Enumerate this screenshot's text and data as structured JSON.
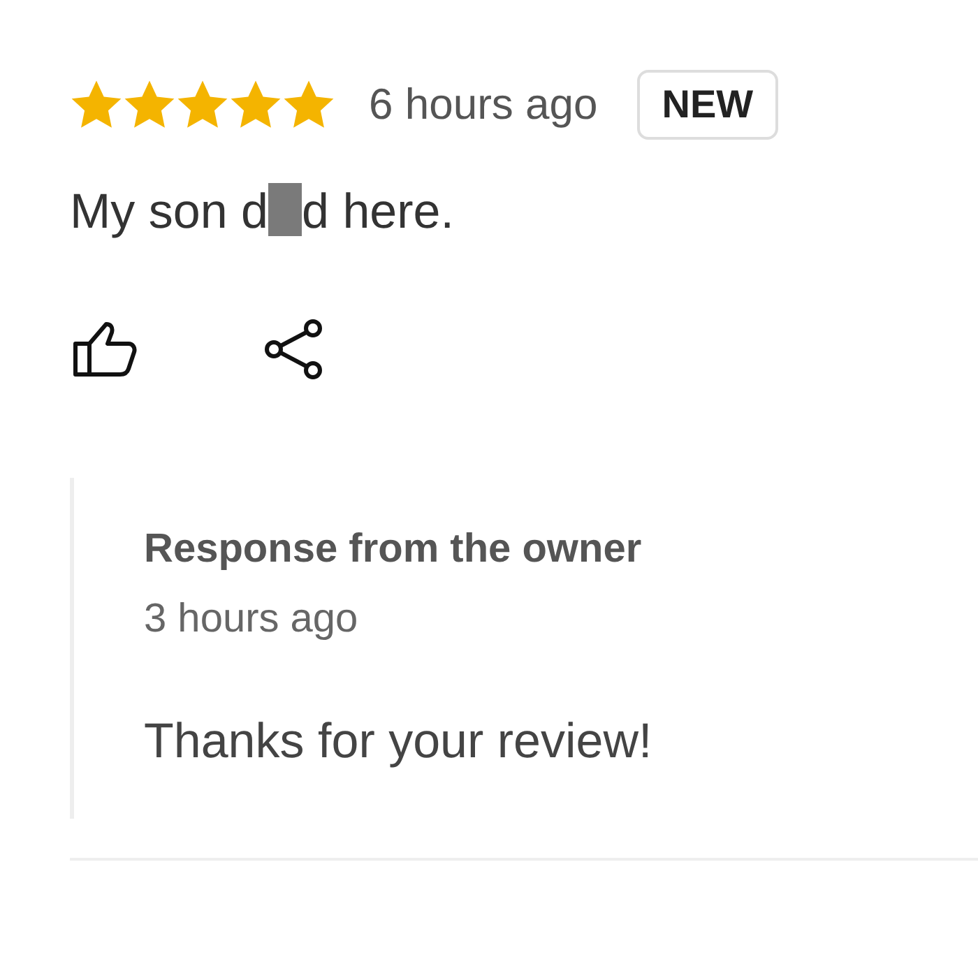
{
  "review": {
    "stars": 5,
    "time": "6 hours ago",
    "badge": "NEW",
    "text_before": "My son d",
    "redacted": true,
    "text_after": "d here."
  },
  "response": {
    "title": "Response from the owner",
    "time": "3 hours ago",
    "text": "Thanks for your review!"
  }
}
